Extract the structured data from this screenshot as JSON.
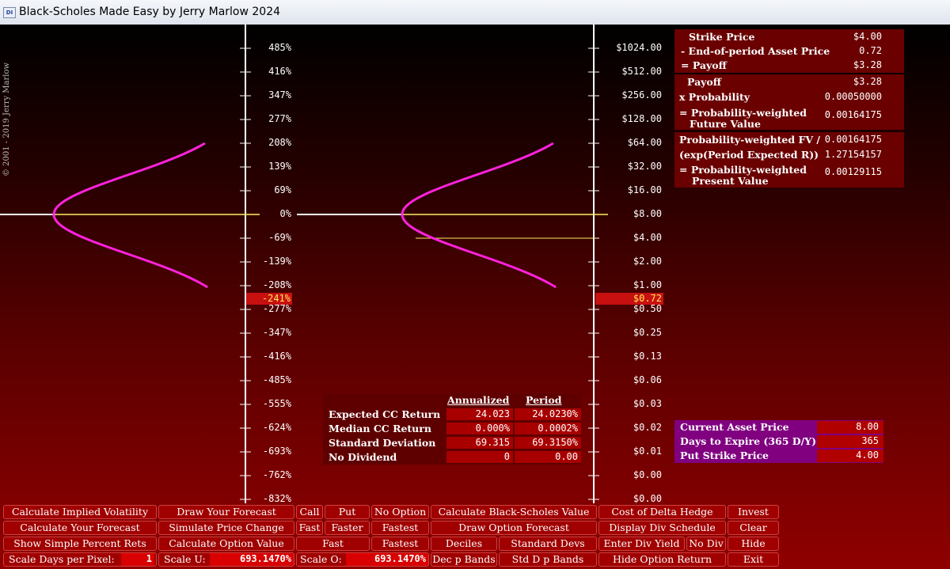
{
  "window": {
    "title": "Black-Scholes Made Easy by Jerry Marlow  2024",
    "icon_text": "DI"
  },
  "copyright": "© 2001 - 2019  Jerry Marlow",
  "left_axis": {
    "labels": [
      "485%",
      "416%",
      "347%",
      "277%",
      "208%",
      "139%",
      "69%",
      "0%",
      "-69%",
      "-139%",
      "-208%",
      "-277%",
      "-347%",
      "-416%",
      "-485%",
      "-555%",
      "-624%",
      "-693%",
      "-762%",
      "-832%"
    ],
    "highlight": "-241%"
  },
  "right_axis": {
    "labels": [
      "$1024.00",
      "$512.00",
      "$256.00",
      "$128.00",
      "$64.00",
      "$32.00",
      "$16.00",
      "$8.00",
      "$4.00",
      "$2.00",
      "$1.00",
      "$0.50",
      "$0.25",
      "$0.13",
      "$0.06",
      "$0.03",
      "$0.02",
      "$0.01",
      "$0.00",
      "$0.00"
    ],
    "highlight": "$0.72"
  },
  "colors": {
    "curve": "#ff22dd",
    "marker_line": "#ffee66",
    "background_top": "#000000",
    "background_bottom": "#900000",
    "input_panel": "#800080"
  },
  "payoff_panel": {
    "rows": [
      {
        "label": "Strike Price",
        "value": "$4.00"
      },
      {
        "label": "- End-of-period Asset Price",
        "value": "0.72"
      },
      {
        "label": "= Payoff",
        "value": "$3.28"
      }
    ]
  },
  "probability_panel": {
    "rows": [
      {
        "label": "Payoff",
        "value": "$3.28"
      },
      {
        "label": "x Probability",
        "value": "0.00050000"
      },
      {
        "label": "= Probability-weighted",
        "label2": "Future Value",
        "value": "0.00164175"
      }
    ]
  },
  "pv_panel": {
    "rows": [
      {
        "label": "Probability-weighted FV /",
        "value": "0.00164175"
      },
      {
        "label": "(exp(Period Expected R))",
        "value": "1.27154157"
      },
      {
        "label": "= Probability-weighted",
        "label2": "Present Value",
        "value": "0.00129115"
      }
    ]
  },
  "stats": {
    "headers": [
      "Annualized",
      "Period"
    ],
    "rows": [
      {
        "label": "Expected CC Return",
        "annualized": "24.023",
        "period": "24.0230%"
      },
      {
        "label": "Median CC Return",
        "annualized": "0.000%",
        "period": "0.0002%"
      },
      {
        "label": "Standard Deviation",
        "annualized": "69.315",
        "period": "69.3150%"
      },
      {
        "label": "No Dividend",
        "annualized": "0",
        "period": "0.00"
      }
    ]
  },
  "inputs": [
    {
      "label": "Current Asset Price",
      "value": "8.00"
    },
    {
      "label": "Days to Expire (365 D/Y)",
      "value": "365"
    },
    {
      "label": "Put Strike Price",
      "value": "4.00"
    }
  ],
  "buttons": {
    "calc_implied_vol": "Calculate Implied Volatility",
    "draw_forecast": "Draw Your Forecast",
    "call": "Call",
    "put": "Put",
    "no_option": "No Option",
    "calc_bs_value": "Calculate Black-Scholes Value",
    "cost_delta_hedge": "Cost of Delta Hedge",
    "invest": "Invest",
    "calc_forecast": "Calculate Your Forecast",
    "simulate_price": "Simulate Price Change",
    "fast": "Fast",
    "faster": "Faster",
    "fastest": "Fastest",
    "draw_option_forecast": "Draw Option Forecast",
    "display_div_schedule": "Display Div Schedule",
    "clear": "Clear",
    "show_simple_pct": "Show Simple Percent Rets",
    "calc_option_value": "Calculate Option  Value",
    "fast2": "Fast",
    "fastest2": "Fastest",
    "deciles": "Deciles",
    "standard_devs": "Standard Devs",
    "enter_div_yield": "Enter Div Yield",
    "no_div": "No Div",
    "hide": "Hide",
    "scale_days": "Scale Days per Pixel:",
    "scale_days_value": "1",
    "scale_u": "Scale U:",
    "scale_u_value": "693.1470%",
    "scale_o": "Scale O:",
    "scale_o_value": "693.1470%",
    "dec_p_bands": "Dec p Bands",
    "std_d_p_bands": "Std D p Bands",
    "hide_option_return": "Hide Option Return",
    "exit": "Exit"
  }
}
